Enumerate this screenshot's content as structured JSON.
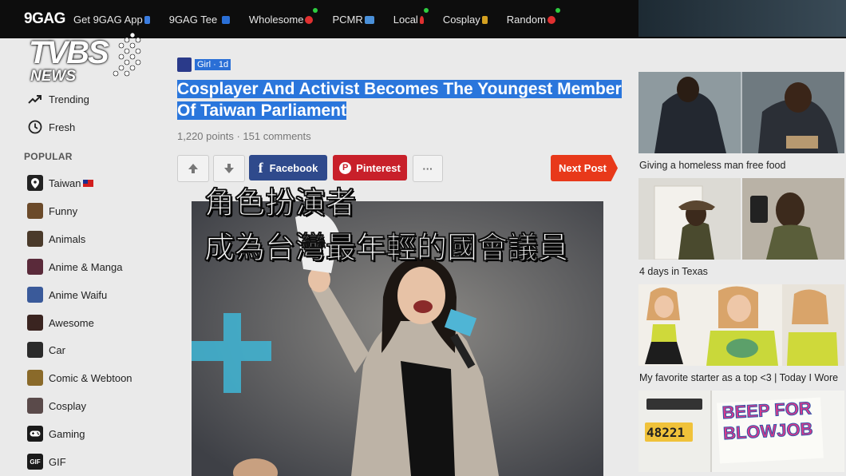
{
  "topbar": {
    "logo": "9GAG",
    "nav": [
      {
        "label": "Get 9GAG App",
        "icon": "phone-icon",
        "color": "#3b7de0",
        "dot": false
      },
      {
        "label": "9GAG Tee",
        "icon": "tshirt-icon",
        "color": "#2a6fd6",
        "dot": false
      },
      {
        "label": "Wholesome",
        "icon": "heart-icon",
        "color": "#e03030",
        "dot": true
      },
      {
        "label": "PCMR",
        "icon": "monitor-icon",
        "color": "#4a90d9",
        "dot": false
      },
      {
        "label": "Local",
        "icon": "pin-icon",
        "color": "#e03030",
        "dot": true
      },
      {
        "label": "Cosplay",
        "icon": "cosplay-icon",
        "color": "#d4a020",
        "dot": false
      },
      {
        "label": "Random",
        "icon": "dice-icon",
        "color": "#e03030",
        "dot": true
      }
    ]
  },
  "watermark": {
    "brand": "TVBS",
    "sub": "NEWS"
  },
  "sidebar": {
    "top_items": [
      {
        "label": "Trending",
        "icon": "trending-icon"
      },
      {
        "label": "Fresh",
        "icon": "clock-icon"
      }
    ],
    "popular_heading": "POPULAR",
    "popular_items": [
      {
        "label": "Taiwan",
        "icon": "pin-icon",
        "flag": true
      },
      {
        "label": "Funny",
        "icon": "funny-icon"
      },
      {
        "label": "Animals",
        "icon": "animals-icon"
      },
      {
        "label": "Anime & Manga",
        "icon": "anime-icon"
      },
      {
        "label": "Anime Waifu",
        "icon": "waifu-icon"
      },
      {
        "label": "Awesome",
        "icon": "awesome-icon"
      },
      {
        "label": "Car",
        "icon": "car-icon"
      },
      {
        "label": "Comic & Webtoon",
        "icon": "comic-icon"
      },
      {
        "label": "Cosplay",
        "icon": "cosplay-icon"
      },
      {
        "label": "Gaming",
        "icon": "gamepad-icon"
      },
      {
        "label": "GIF",
        "icon": "gif-icon"
      }
    ]
  },
  "post": {
    "tag": "Girl · 1d",
    "title": "Cosplayer And Activist Becomes The Youngest Member Of Taiwan Parliament",
    "meta": "1,220 points · 151 comments",
    "facebook_label": "Facebook",
    "pinterest_label": "Pinterest",
    "more_label": "···",
    "next_label": "Next Post"
  },
  "caption": {
    "line1": "角色扮演者",
    "line2": "成為台灣最年輕的國會議員"
  },
  "related": [
    {
      "caption": "Giving a homeless man free food"
    },
    {
      "caption": "4 days in Texas"
    },
    {
      "caption": "My favorite starter as a top <3 | Today I Wore"
    },
    {
      "caption": "",
      "sign_text_1": "BEEP FOR",
      "sign_text_2": "BLOWJOB",
      "plate": "48221"
    }
  ],
  "colors": {
    "accent_highlight": "#2a76dc",
    "facebook": "#2f4a8c",
    "pinterest": "#c8202a",
    "next_post": "#e8391a"
  }
}
